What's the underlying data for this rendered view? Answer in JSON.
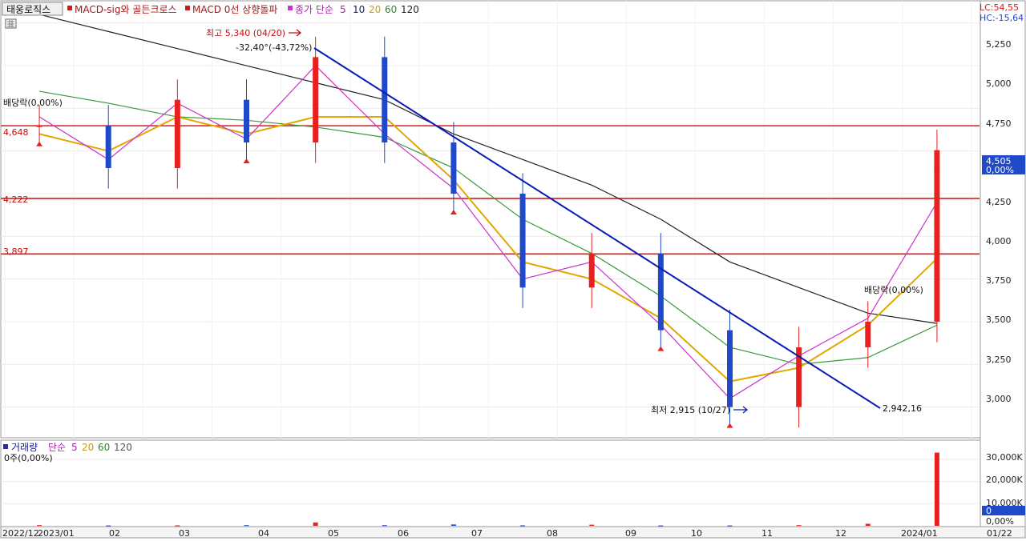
{
  "header": {
    "stock_name": "태웅로직스",
    "indicator_1": "MACD-sig와 골든크로스",
    "indicator_2": "MACD 0선 상향돌파",
    "ma_label": "종가 단순",
    "ma_periods": [
      "5",
      "10",
      "20",
      "60",
      "120"
    ],
    "lc": "LC:54,55",
    "hc": "HC:-15,64"
  },
  "price_panel": {
    "y_ticks": [
      "5,250",
      "5,000",
      "4,750",
      "4,500",
      "4,250",
      "4,000",
      "3,750",
      "3,500",
      "3,250",
      "3,000"
    ],
    "current_price": "4,505",
    "current_change": "0,00%",
    "hlines": [
      {
        "label": "4,648",
        "value": 4648
      },
      {
        "label": "4,222",
        "value": 4222
      },
      {
        "label": "3,897",
        "value": 3897
      }
    ],
    "trendline_label": "2,942,16",
    "high_label": "최고 5,340 (04/20)",
    "high_sub_label": "-32,40°(-43,72%)",
    "low_label": "최저 2,915 (10/27)",
    "left_note": "배당락(0,00%)",
    "right_note": "배당락(0,00%)"
  },
  "volume_panel": {
    "title": "거래량",
    "ma_label": "단순",
    "ma_periods": [
      "5",
      "20",
      "60",
      "120"
    ],
    "sub_label": "0주(0,00%)",
    "y_ticks": [
      "30,000K",
      "20,000K",
      "10,000K",
      "0,00%"
    ],
    "current": "0"
  },
  "x_axis": {
    "labels": [
      "2022/12",
      "2023/01",
      "02",
      "03",
      "04",
      "05",
      "06",
      "07",
      "08",
      "09",
      "10",
      "11",
      "12",
      "2024/01",
      "01/22"
    ]
  },
  "colors": {
    "up": "#e8201e",
    "down": "#1f49c9",
    "ma5": "#cc33cc",
    "ma10": "#1a1a60",
    "ma20": "#e0a800",
    "ma60": "#3a9a3a",
    "ma120": "#222222",
    "hline": "#e01818",
    "trendline": "#0a1ab4"
  },
  "chart_data": {
    "type": "candlestick",
    "x": [
      "2022-12",
      "2023-01",
      "2023-02",
      "2023-03",
      "2023-04",
      "2023-05",
      "2023-06",
      "2023-07",
      "2023-08",
      "2023-09",
      "2023-10",
      "2023-11",
      "2023-12",
      "2024-01"
    ],
    "series": [
      {
        "name": "종가",
        "values": [
          4650,
          4400,
          4800,
          4550,
          5050,
          4550,
          4250,
          3700,
          3900,
          3450,
          3000,
          3350,
          3500,
          4505
        ]
      },
      {
        "name": "5",
        "values": [
          4700,
          4450,
          4780,
          4570,
          5000,
          4600,
          4280,
          3750,
          3850,
          3480,
          3050,
          3300,
          3520,
          4200
        ]
      },
      {
        "name": "20",
        "values": [
          4600,
          4500,
          4700,
          4600,
          4700,
          4700,
          4330,
          3850,
          3750,
          3520,
          3150,
          3230,
          3480,
          3870
        ]
      },
      {
        "name": "60",
        "values": [
          4850,
          4780,
          4700,
          4680,
          4640,
          4580,
          4400,
          4100,
          3900,
          3650,
          3350,
          3250,
          3290,
          3480
        ]
      },
      {
        "name": "120",
        "values": [
          5300,
          5200,
          5100,
          5000,
          4900,
          4800,
          4600,
          4450,
          4300,
          4100,
          3850,
          3700,
          3550,
          3490
        ]
      },
      {
        "name": "거래량",
        "values": [
          300,
          150,
          200,
          300,
          1500,
          300,
          600,
          200,
          500,
          150,
          150,
          300,
          900,
          33000
        ]
      }
    ],
    "annotations": [
      {
        "text": "최고 5,340 (04/20)",
        "x": "2023-04-20",
        "y": 5340
      },
      {
        "text": "최저 2,915 (10/27)",
        "x": "2023-10-27",
        "y": 2915
      },
      {
        "text": "2,942,16",
        "x": "2024-01",
        "y": 2942.16
      }
    ],
    "hlines": [
      4648,
      4222,
      3897
    ],
    "ylim": [
      2820,
      5380
    ],
    "volume_ylim": [
      0,
      35000
    ],
    "volume_unit": "K",
    "grid": true
  }
}
